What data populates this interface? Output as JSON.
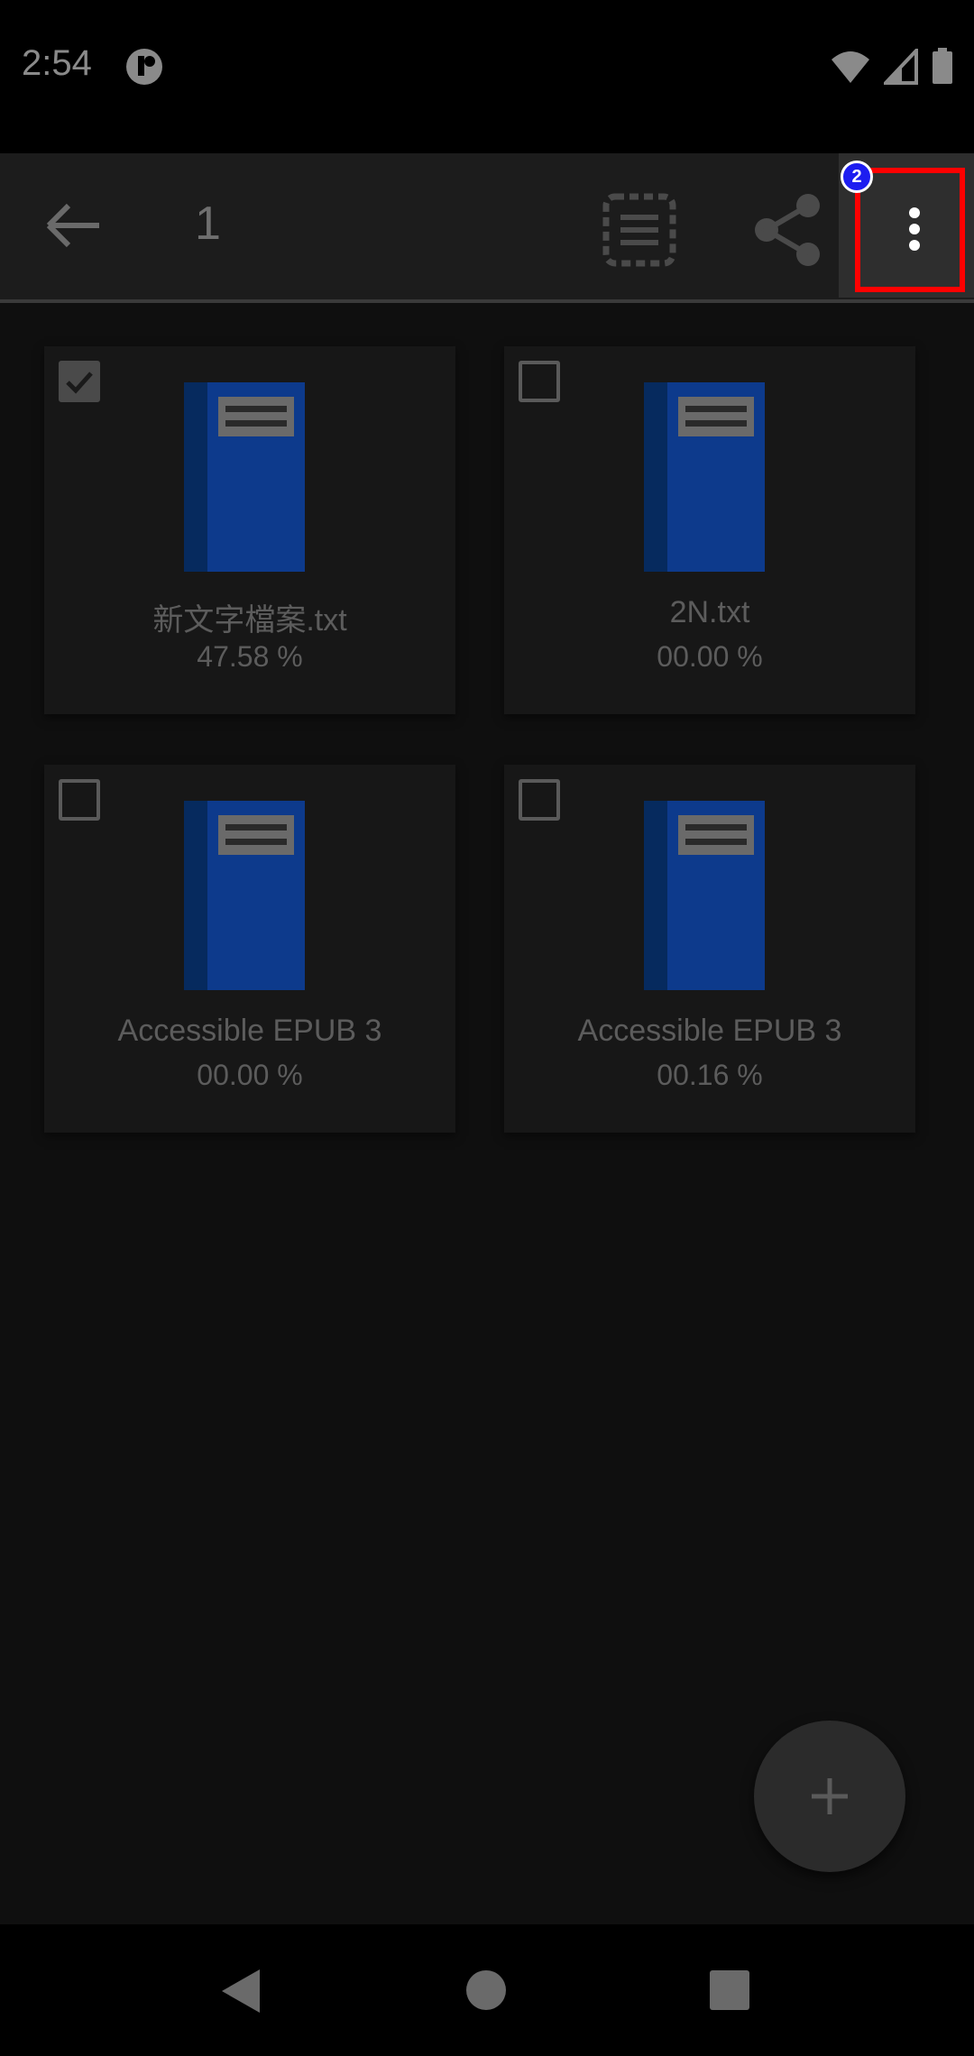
{
  "status_bar": {
    "time": "2:54"
  },
  "toolbar": {
    "selected_count": "1"
  },
  "annotation": {
    "badge": "2"
  },
  "files": [
    {
      "name": "新文字檔案.txt",
      "progress": "47.58 %",
      "checked": true
    },
    {
      "name": "2N.txt",
      "progress": "00.00 %",
      "checked": false
    },
    {
      "name": "Accessible EPUB 3",
      "progress": "00.00 %",
      "checked": false
    },
    {
      "name": "Accessible EPUB 3",
      "progress": "00.16 %",
      "checked": false
    }
  ],
  "colors": {
    "book_cover": "#0d3a8c",
    "book_spine": "#062a5e",
    "highlight": "#ff0000",
    "badge": "#1d1df0"
  },
  "icons": {
    "back": "arrow-back-icon",
    "select_all": "select-all-icon",
    "share": "share-icon",
    "more": "more-vert-icon",
    "fab": "plus-icon",
    "nav_back": "nav-back-icon",
    "nav_home": "nav-home-icon",
    "nav_recents": "nav-recents-icon"
  }
}
